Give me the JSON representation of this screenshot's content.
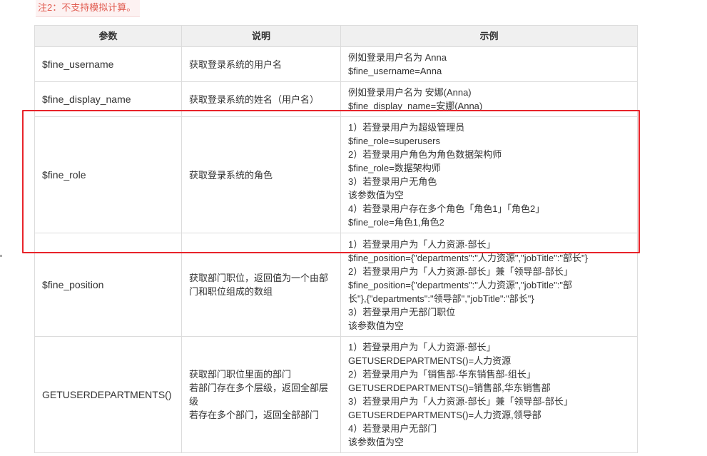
{
  "note": "注2：不支持模拟计算。",
  "table": {
    "headers": [
      "参数",
      "说明",
      "示例"
    ],
    "rows": [
      {
        "param": "$fine_username",
        "desc": [
          "获取登录系统的用户名"
        ],
        "example": [
          "例如登录用户名为 Anna",
          "$fine_username=Anna"
        ]
      },
      {
        "param": "$fine_display_name",
        "desc": [
          "获取登录系统的姓名（用户名）"
        ],
        "example": [
          "例如登录用户名为 安娜(Anna)",
          "$fine_display_name=安娜(Anna)"
        ]
      },
      {
        "param": "$fine_role",
        "desc": [
          "获取登录系统的角色"
        ],
        "example": [
          "1）若登录用户为超级管理员",
          "$fine_role=superusers",
          "2）若登录用户角色为角色数据架构师",
          "$fine_role=数据架构师",
          "3）若登录用户无角色",
          "该参数值为空",
          "4）若登录用户存在多个角色「角色1」「角色2」",
          "$fine_role=角色1,角色2"
        ]
      },
      {
        "param": "$fine_position",
        "desc": [
          "获取部门职位，返回值为一个由部门和职位组成的数组"
        ],
        "example": [
          "1）若登录用户为「人力资源-部长」",
          "$fine_position={\"departments\":\"人力资源\",\"jobTitle\":\"部长\"}",
          "2）若登录用户为「人力资源-部长」兼「领导部-部长」",
          "$fine_position={\"departments\":\"人力资源\",\"jobTitle\":\"部",
          "长\"},{\"departments\":\"领导部\",\"jobTitle\":\"部长\"}",
          "3）若登录用户无部门职位",
          "该参数值为空"
        ]
      },
      {
        "param": "GETUSERDEPARTMENTS()",
        "desc": [
          "获取部门职位里面的部门",
          "若部门存在多个层级，返回全部层级",
          "若存在多个部门，返回全部部门"
        ],
        "example": [
          "1）若登录用户为「人力资源-部长」",
          "GETUSERDEPARTMENTS()=人力资源",
          "2）若登录用户为「销售部-华东销售部-组长」",
          "GETUSERDEPARTMENTS()=销售部,华东销售部",
          "3）若登录用户为「人力资源-部长」兼「领导部-部长」",
          "GETUSERDEPARTMENTS()=人力资源,领导部",
          "4）若登录用户无部门",
          "该参数值为空"
        ]
      }
    ]
  }
}
